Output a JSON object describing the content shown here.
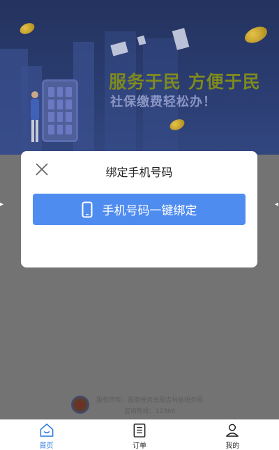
{
  "banner": {
    "slogan_main": "服务于民 方便于民",
    "slogan_sub": "社保缴费轻松办！"
  },
  "modal": {
    "title": "绑定手机号码",
    "bind_button_label": "手机号码一键绑定",
    "close_icon": "close-icon",
    "button_icon": "phone-icon"
  },
  "footer": {
    "copyright": "版权所有：国家税务总局吉林省税务局",
    "hotline": "咨询热线：12366"
  },
  "tabbar": {
    "items": [
      {
        "label": "首页",
        "icon": "home-icon",
        "active": true
      },
      {
        "label": "订单",
        "icon": "order-list-icon",
        "active": false
      },
      {
        "label": "我的",
        "icon": "user-icon",
        "active": false
      }
    ]
  },
  "colors": {
    "accent": "#4f8cf0",
    "tab_active": "#2f7de0",
    "overlay": "#737373"
  }
}
